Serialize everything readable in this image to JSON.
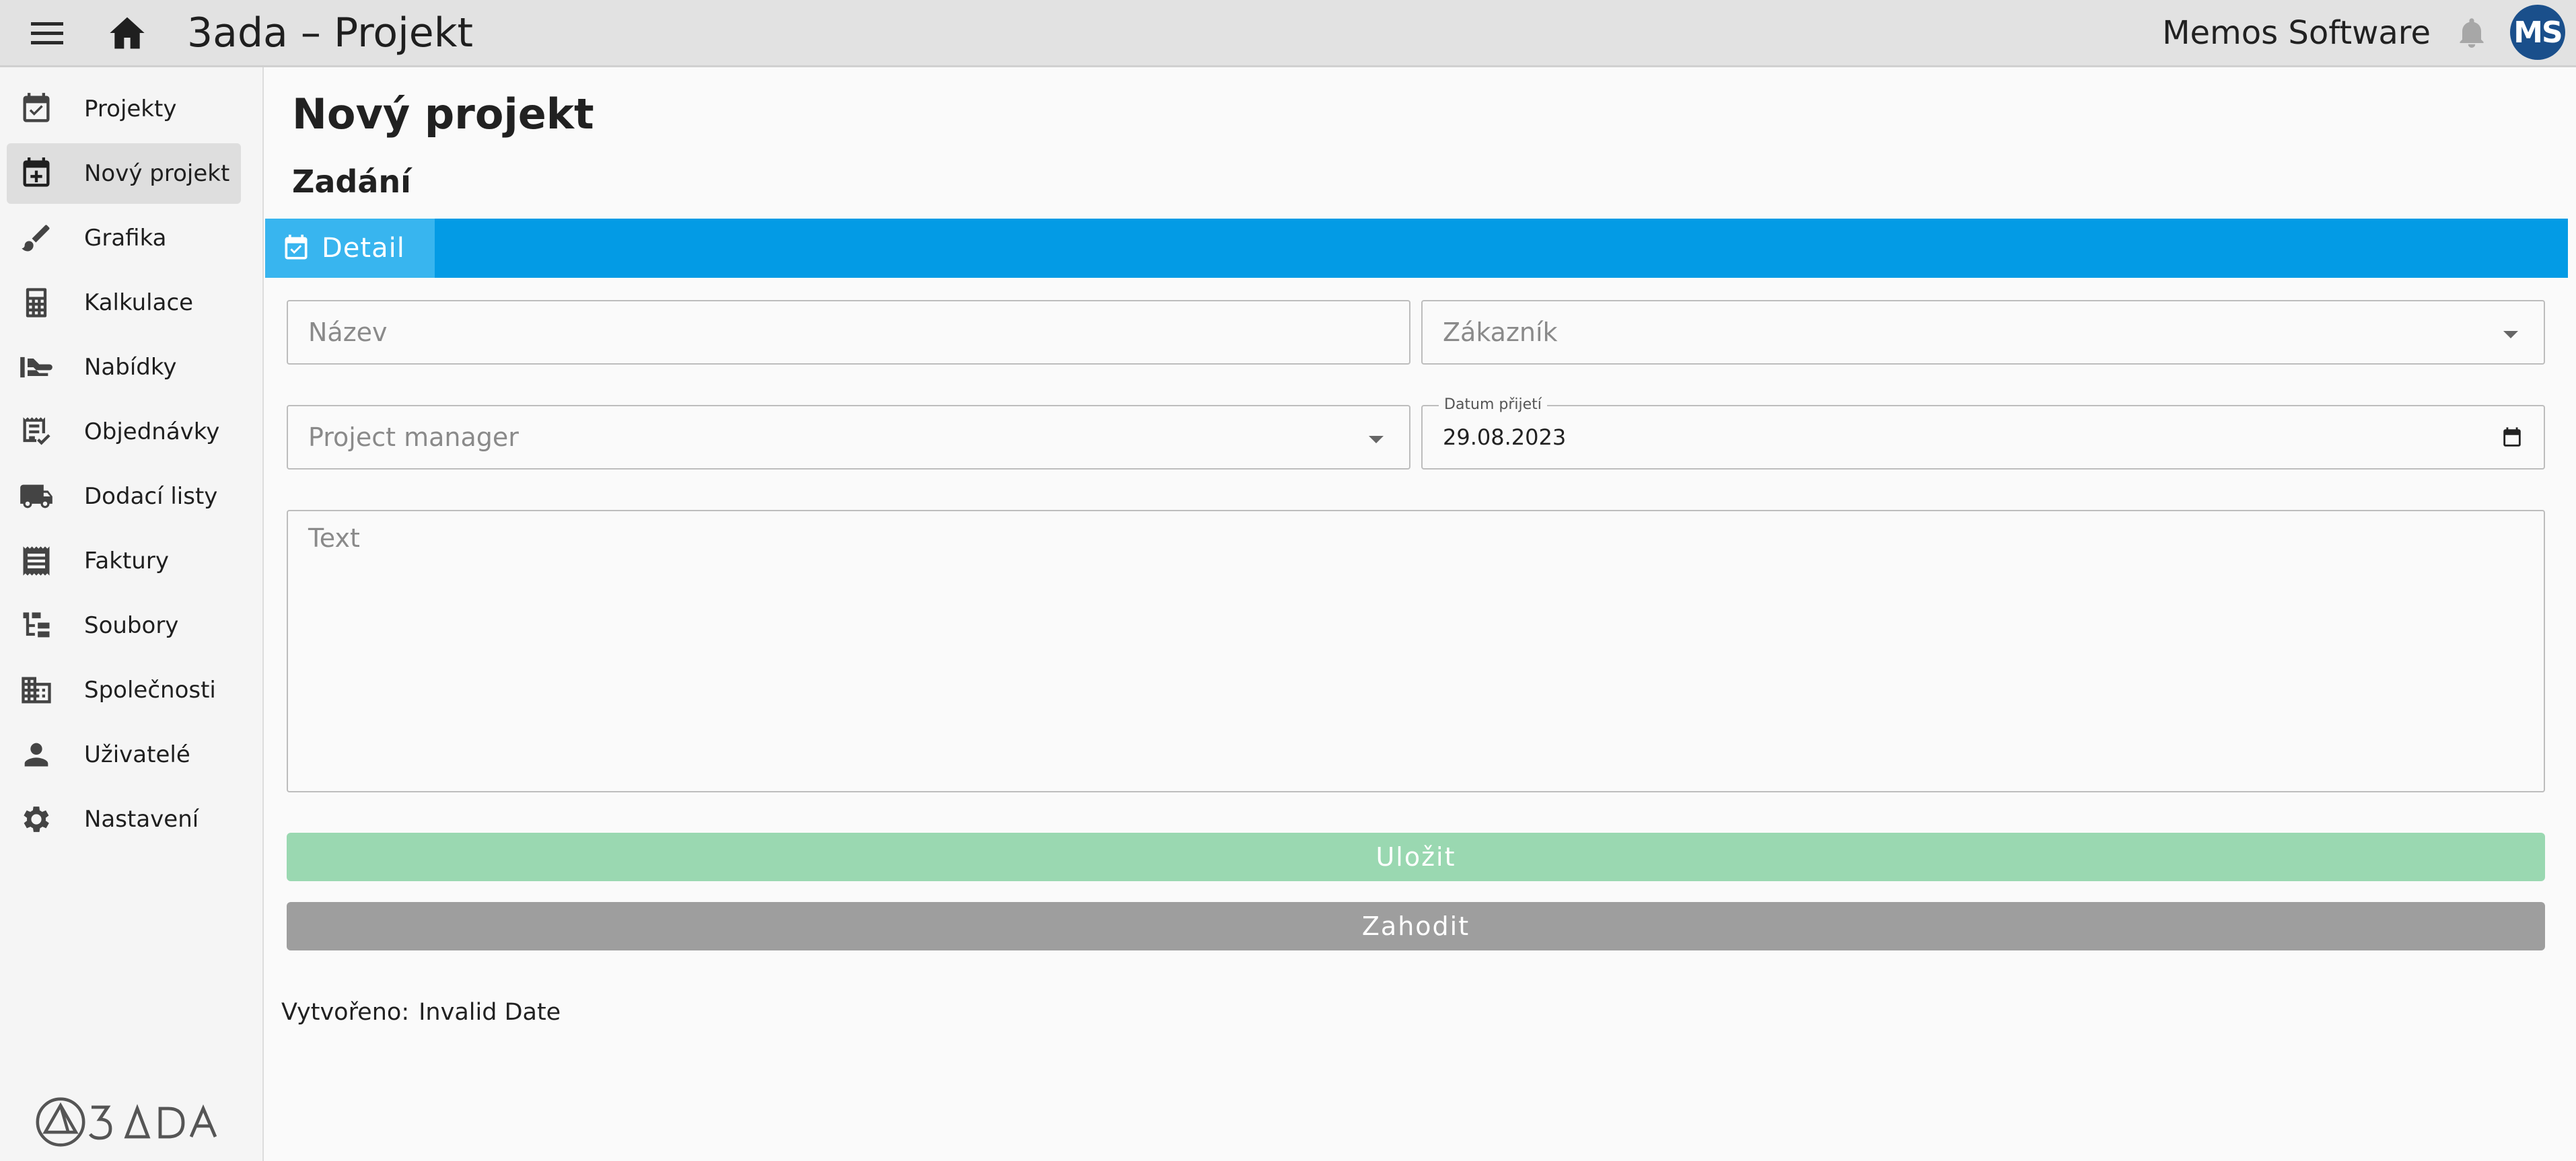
{
  "header": {
    "title": "3ada – Projekt",
    "organization": "Memos Software",
    "avatar_initials": "MS",
    "icons": [
      "menu-icon",
      "home-icon",
      "bell-icon"
    ]
  },
  "sidebar": {
    "items": [
      {
        "label": "Projekty",
        "icon": "calendar-check-icon",
        "active": false
      },
      {
        "label": "Nový projekt",
        "icon": "calendar-plus-icon",
        "active": true
      },
      {
        "label": "Grafika",
        "icon": "brush-icon",
        "active": false
      },
      {
        "label": "Kalkulace",
        "icon": "calculator-icon",
        "active": false
      },
      {
        "label": "Nabídky",
        "icon": "hand-offer-icon",
        "active": false
      },
      {
        "label": "Objednávky",
        "icon": "order-list-icon",
        "active": false
      },
      {
        "label": "Dodací listy",
        "icon": "truck-icon",
        "active": false
      },
      {
        "label": "Faktury",
        "icon": "receipt-icon",
        "active": false
      },
      {
        "label": "Soubory",
        "icon": "file-tree-icon",
        "active": false
      },
      {
        "label": "Společnosti",
        "icon": "building-icon",
        "active": false
      },
      {
        "label": "Uživatelé",
        "icon": "person-icon",
        "active": false
      },
      {
        "label": "Nastavení",
        "icon": "gear-icon",
        "active": false
      }
    ],
    "logo_text": "3ADA"
  },
  "main": {
    "page_title": "Nový projekt",
    "section_title": "Zadání",
    "tabs": [
      {
        "label": "Detail",
        "icon": "calendar-check-icon",
        "active": true
      }
    ],
    "form": {
      "name": {
        "placeholder": "Název",
        "value": ""
      },
      "customer": {
        "placeholder": "Zákazník",
        "value": ""
      },
      "project_manager": {
        "placeholder": "Project manager",
        "value": ""
      },
      "date_received": {
        "label": "Datum přijetí",
        "value": "29.08.2023"
      },
      "text": {
        "placeholder": "Text",
        "value": ""
      }
    },
    "buttons": {
      "save": "Uložit",
      "discard": "Zahodit"
    },
    "created": {
      "label": "Vytvořeno:",
      "value": "Invalid Date"
    }
  },
  "colors": {
    "tab_bar": "#039be5",
    "tab_active": "#38b5ef",
    "save_button": "#9ad8b1",
    "discard_button": "#9e9e9e",
    "avatar": "#1a4f8b"
  }
}
